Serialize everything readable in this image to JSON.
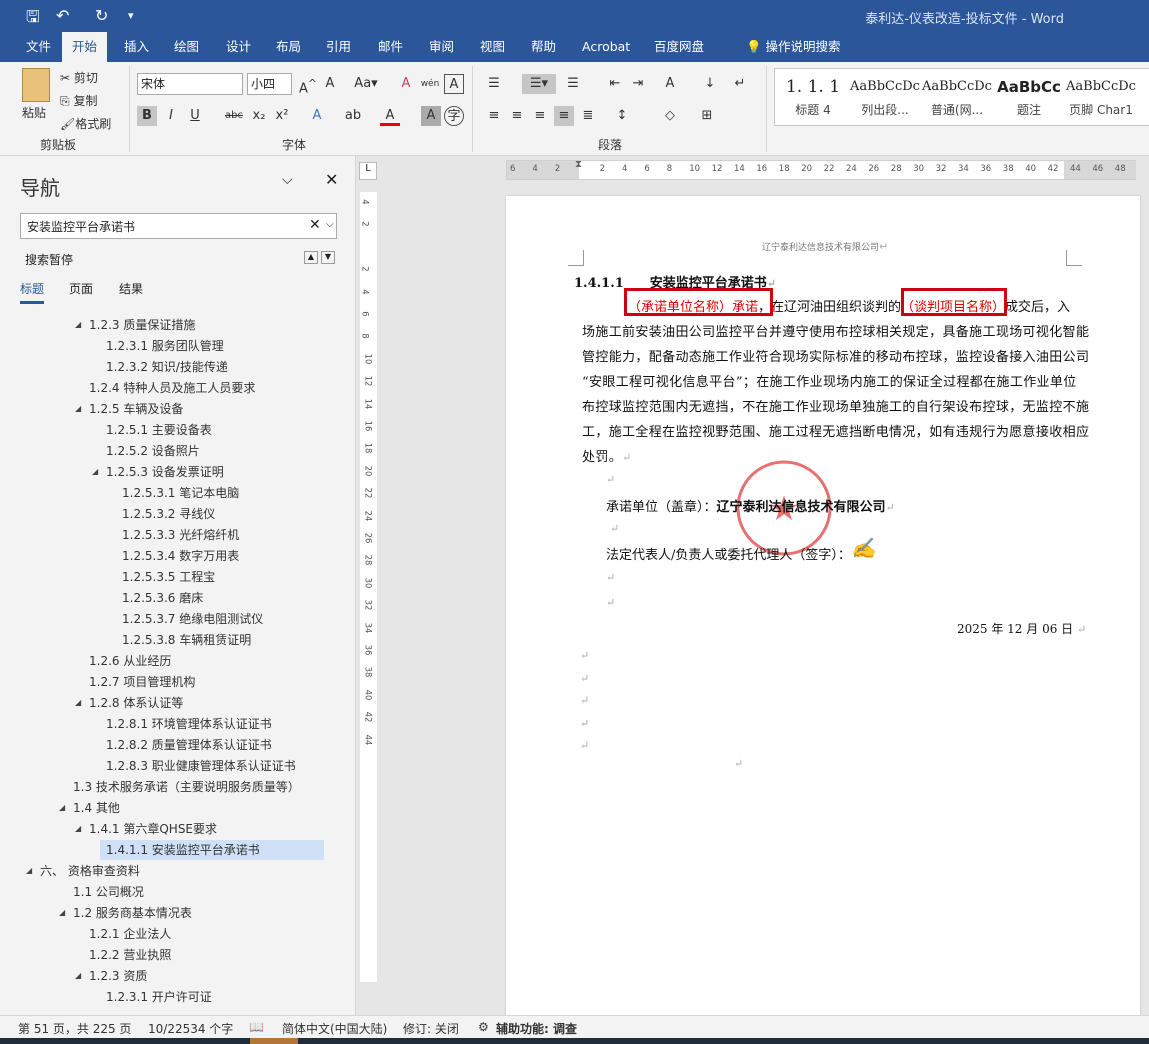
{
  "titlebar": {
    "title": "泰利达-仪表改造-投标文件  -  Word",
    "save_icon": "save-icon",
    "undo_icon": "undo-icon",
    "redo_icon": "redo-icon"
  },
  "tabs": [
    "文件",
    "开始",
    "插入",
    "绘图",
    "设计",
    "布局",
    "引用",
    "邮件",
    "审阅",
    "视图",
    "帮助",
    "Acrobat",
    "百度网盘"
  ],
  "tell_me": "操作说明搜索",
  "ribbon": {
    "clipboard": {
      "paste": "粘贴",
      "cut": "剪切",
      "copy": "复制",
      "format_painter": "格式刷",
      "group": "剪贴板"
    },
    "font": {
      "name": "宋体",
      "size": "小四",
      "group": "字体"
    },
    "paragraph": {
      "group": "段落"
    },
    "styles": [
      {
        "preview": "1. 1. 1",
        "name": "标题 4"
      },
      {
        "preview": "AaBbCcDc",
        "name": "列出段..."
      },
      {
        "preview": "AaBbCcDc",
        "name": "普通(网..."
      },
      {
        "preview": "AaBbCc",
        "name": "题注"
      },
      {
        "preview": "AaBbCcDc",
        "name": "页脚 Char1"
      }
    ]
  },
  "nav": {
    "title": "导航",
    "search_value": "安装监控平台承诺书",
    "paused": "搜索暂停",
    "tabs": [
      "标题",
      "页面",
      "结果"
    ],
    "items": [
      {
        "lv": 2,
        "exp": true,
        "t": "1.2.3 质量保证措施"
      },
      {
        "lv": 3,
        "t": "1.2.3.1 服务团队管理"
      },
      {
        "lv": 3,
        "t": "1.2.3.2 知识/技能传递"
      },
      {
        "lv": 2,
        "t": "1.2.4 特种人员及施工人员要求"
      },
      {
        "lv": 2,
        "exp": true,
        "t": "1.2.5 车辆及设备"
      },
      {
        "lv": 3,
        "t": "1.2.5.1 主要设备表"
      },
      {
        "lv": 3,
        "t": "1.2.5.2 设备照片"
      },
      {
        "lv": 3,
        "exp": true,
        "t": "1.2.5.3 设备发票证明"
      },
      {
        "lv": 4,
        "t": "1.2.5.3.1 笔记本电脑"
      },
      {
        "lv": 4,
        "t": "1.2.5.3.2 寻线仪"
      },
      {
        "lv": 4,
        "t": "1.2.5.3.3 光纤熔纤机"
      },
      {
        "lv": 4,
        "t": "1.2.5.3.4 数字万用表"
      },
      {
        "lv": 4,
        "t": "1.2.5.3.5 工程宝"
      },
      {
        "lv": 4,
        "t": "1.2.5.3.6 磨床"
      },
      {
        "lv": 4,
        "t": "1.2.5.3.7 绝缘电阻测试仪"
      },
      {
        "lv": 4,
        "t": "1.2.5.3.8 车辆租赁证明"
      },
      {
        "lv": 2,
        "t": "1.2.6 从业经历"
      },
      {
        "lv": 2,
        "t": "1.2.7 项目管理机构"
      },
      {
        "lv": 2,
        "exp": true,
        "t": "1.2.8 体系认证等"
      },
      {
        "lv": 3,
        "t": "1.2.8.1 环境管理体系认证证书"
      },
      {
        "lv": 3,
        "t": "1.2.8.2 质量管理体系认证证书"
      },
      {
        "lv": 3,
        "t": "1.2.8.3 职业健康管理体系认证证书"
      },
      {
        "lv": 1,
        "t": "1.3 技术服务承诺（主要说明服务质量等）"
      },
      {
        "lv": 1,
        "exp": true,
        "t": "1.4 其他"
      },
      {
        "lv": 2,
        "exp": true,
        "t": "1.4.1 第六章QHSE要求"
      },
      {
        "lv": 3,
        "sel": true,
        "t": "1.4.1.1 安装监控平台承诺书"
      },
      {
        "lv": 0,
        "exp": true,
        "t": "六、 资格审查资料"
      },
      {
        "lv": 1,
        "t": "1.1 公司概况"
      },
      {
        "lv": 1,
        "exp": true,
        "t": "1.2 服务商基本情况表"
      },
      {
        "lv": 2,
        "t": "1.2.1 企业法人"
      },
      {
        "lv": 2,
        "t": "1.2.2 营业执照"
      },
      {
        "lv": 2,
        "exp": true,
        "t": "1.2.3 资质"
      },
      {
        "lv": 3,
        "t": "1.2.3.1 开户许可证"
      }
    ]
  },
  "hruler": [
    "6",
    "4",
    "2",
    "",
    "2",
    "4",
    "6",
    "8",
    "10",
    "12",
    "14",
    "16",
    "18",
    "20",
    "22",
    "24",
    "26",
    "28",
    "30",
    "32",
    "34",
    "36",
    "38",
    "40",
    "42",
    "44",
    "46",
    "48"
  ],
  "vruler": [
    "4",
    "2",
    "",
    "2",
    "4",
    "6",
    "8",
    "10",
    "12",
    "14",
    "16",
    "18",
    "20",
    "22",
    "24",
    "26",
    "28",
    "30",
    "32",
    "34",
    "36",
    "38",
    "40",
    "42",
    "44"
  ],
  "doc": {
    "header": "辽宁泰利达信息技术有限公司",
    "heading_num": "1.4.1.1",
    "heading": "安装监控平台承诺书",
    "p1_red1": "（承诺单位名称）承诺",
    "p1_mid": "，在辽河油田组织谈判的",
    "p1_red2": "（谈判项目名称）",
    "p1_end": "成交后，入",
    "lines": [
      "场施工前安装油田公司监控平台并遵守使用布控球相关规定，具备施工现场可视化智能",
      "管控能力，配备动态施工作业符合现场实际标准的移动布控球，监控设备接入油田公司",
      "“安眼工程可视化信息平台”；在施工作业现场内施工的保证全过程都在施工作业单位",
      "布控球监控范围内无遮挡，不在施工作业现场单独施工的自行架设布控球，无监控不施",
      "工，施工全程在监控视野范围、施工过程无遮挡断电情况，如有违规行为愿意接收相应",
      "处罚。"
    ],
    "unit_label": "承诺单位（盖章）：",
    "unit_name": "辽宁泰利达信息技术有限公司",
    "rep_label": "法定代表人/负责人或委托代理人（签字）：",
    "signature": "李雪梅",
    "seal_text": "辽宁泰利达信息技术有限公司",
    "date": "2025 年  12 月 06 日"
  },
  "status": {
    "page": "第 51 页，共 225 页",
    "words": "10/22534 个字",
    "lang": "简体中文(中国大陆)",
    "track": "修订: 关闭",
    "access": "辅助功能: 调查"
  }
}
